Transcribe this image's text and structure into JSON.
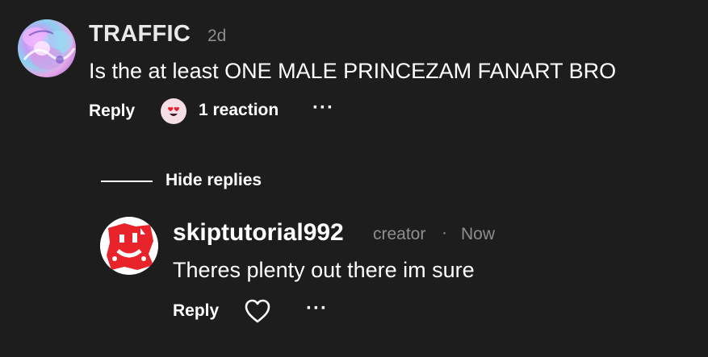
{
  "comment": {
    "username": "TRAFFIC",
    "time": "2d",
    "text": "Is the at least ONE MALE PRINCEZAM FANART BRO",
    "reply_label": "Reply",
    "reaction_label": "1 reaction",
    "more_label": "···",
    "avatar_icon": "anime-girl-avatar",
    "reaction_icon": "heart-eyes-face-icon"
  },
  "thread": {
    "hide_replies_label": "Hide replies"
  },
  "reply": {
    "username": "skiptutorial992",
    "badge": "creator",
    "separator": "·",
    "time": "Now",
    "text": "Theres plenty out there im sure",
    "reply_label": "Reply",
    "more_label": "···",
    "like_icon": "heart-outline-icon",
    "avatar_icon": "red-white-graphic-avatar"
  },
  "colors": {
    "background": "#1e1d1e",
    "muted_text": "#8e8d90",
    "avatar_red": "#e8232a"
  }
}
